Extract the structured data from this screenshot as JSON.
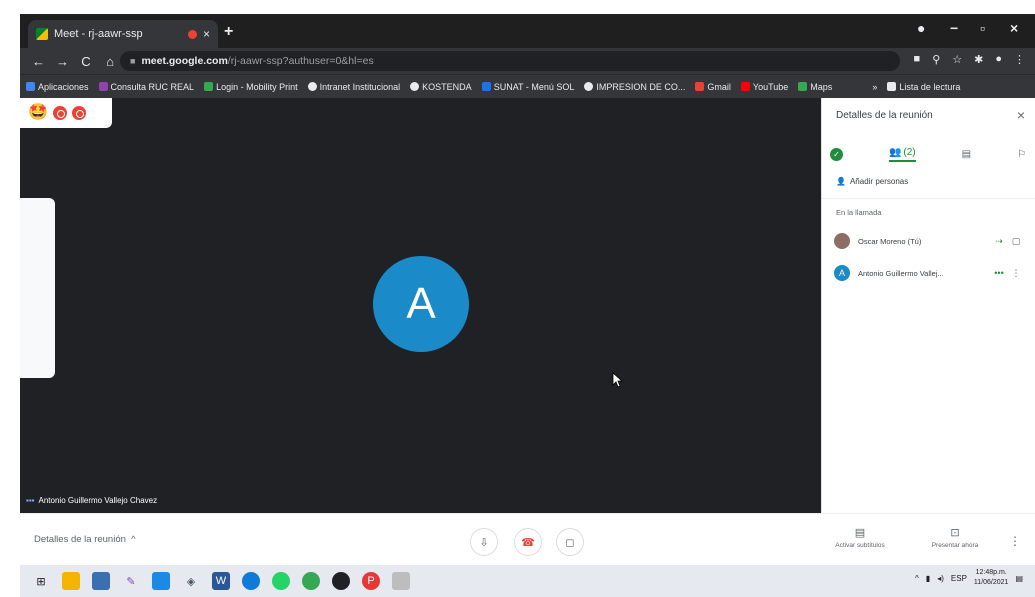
{
  "browser": {
    "tab_title": "Meet - rj-aawr-ssp",
    "tab_close": "×",
    "new_tab": "+",
    "url_host": "meet.google.com",
    "url_path": "/rj-aawr-ssp?authuser=0&hl=es",
    "nav": {
      "back": "←",
      "forward": "→",
      "reload": "C",
      "home": "⌂"
    },
    "window_controls": {
      "profile": "●",
      "minimize": "−",
      "maximize": "▫",
      "close": "×"
    },
    "bookmarks": [
      {
        "label": "Aplicaciones",
        "color": "#4285f4"
      },
      {
        "label": "Consulta RUC REAL",
        "color": "#8e44ad"
      },
      {
        "label": "Login - Mobility Print",
        "color": "#34a853"
      },
      {
        "label": "Intranet Institucional",
        "color": "#e8eaed"
      },
      {
        "label": "KOSTENDA",
        "color": "#e8eaed"
      },
      {
        "label": "SUNAT - Menú SOL",
        "color": "#1a73e8"
      },
      {
        "label": "IMPRESION DE CO...",
        "color": "#e8eaed"
      },
      {
        "label": "Gmail",
        "color": "#ea4335"
      },
      {
        "label": "YouTube",
        "color": "#ff0000"
      },
      {
        "label": "Maps",
        "color": "#34a853"
      }
    ],
    "bookmarks_overflow": "»",
    "reading_list": "Lista de lectura"
  },
  "meeting": {
    "participant_initial": "A",
    "participant_name": "Antonio Guillermo Vallejo Chavez",
    "emoji_icon": "🤩"
  },
  "panel": {
    "title": "Detalles de la reunión",
    "close": "×",
    "people_count": "(2)",
    "add_people": "Añadir personas",
    "in_call": "En la llamada",
    "participants": [
      {
        "name": "Oscar Moreno (Tú)",
        "avatar_color": "#8d6e63",
        "initial": ""
      },
      {
        "name": "Antonio Guillermo Vallej...",
        "avatar_color": "#1b8ac9",
        "initial": "A"
      }
    ]
  },
  "bottom": {
    "details_label": "Detalles de la reunión",
    "captions_label": "Activar subtítulos",
    "present_label": "Presentar ahora",
    "more": "⋮"
  },
  "taskbar": {
    "time": "12:48p.m.",
    "date": "11/06/2021",
    "lang": "ESP"
  }
}
